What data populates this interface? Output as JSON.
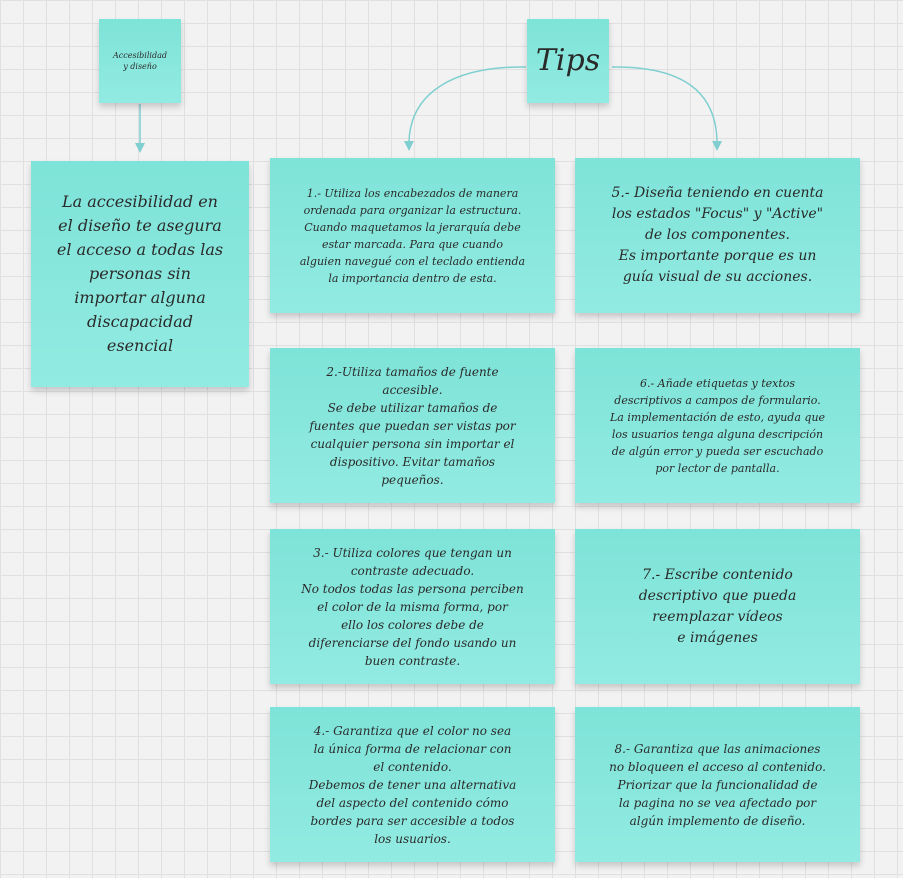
{
  "notes": {
    "topic": "Accesibilidad\ny diseño",
    "tips_title": "Tips",
    "summary": "La accesibilidad en\nel diseño te asegura\nel acceso a todas las\npersonas sin\nimportar alguna\ndiscapacidad\nesencial",
    "tip1": "1.- Utiliza los encabezados de manera\nordenada para organizar la estructura.\nCuando maquetamos la jerarquía debe\nestar marcada. Para que cuando\nalguien navegué con el teclado entienda\nla importancia dentro de esta.",
    "tip2": "2.-Utiliza tamaños de fuente\naccesible.\nSe debe utilizar tamaños de\nfuentes que puedan ser vistas por\ncualquier persona sin importar el\ndispositivo. Evitar tamaños\npequeños.",
    "tip3": "3.- Utiliza colores que tengan un\ncontraste adecuado.\nNo todos todas las persona perciben\nel color de la misma forma, por\nello los colores debe de\ndiferenciarse del fondo usando un\nbuen contraste.",
    "tip4": "4.- Garantiza que el color no sea\nla única forma de relacionar con\nel contenido.\nDebemos de tener una alternativa\ndel aspecto del contenido cómo\nbordes para ser accesible a todos\nlos usuarios.",
    "tip5": "5.- Diseña teniendo en cuenta\nlos estados \"Focus\" y \"Active\"\nde los componentes.\nEs importante porque es un\nguía visual de su acciones.",
    "tip6": "6.- Añade etiquetas y textos\ndescriptivos a campos de formulario.\nLa implementación de esto, ayuda que\nlos usuarios tenga alguna descripción\nde algún error y pueda ser escuchado\npor lector de pantalla.",
    "tip7": "7.- Escribe contenido\ndescriptivo que pueda\nreemplazar vídeos\ne imágenes",
    "tip8": "8.- Garantiza que las animaciones\nno bloqueen el acceso al contenido.\nPriorizar que la funcionalidad de\nla pagina no se vea afectado por\nalgún implemento de diseño."
  },
  "colors": {
    "note_top": "#7ee3d8",
    "note_bottom": "#92ebe2",
    "connector": "#7fcfd0",
    "canvas": "#f2f2f2",
    "grid": "#e0e0e0"
  }
}
